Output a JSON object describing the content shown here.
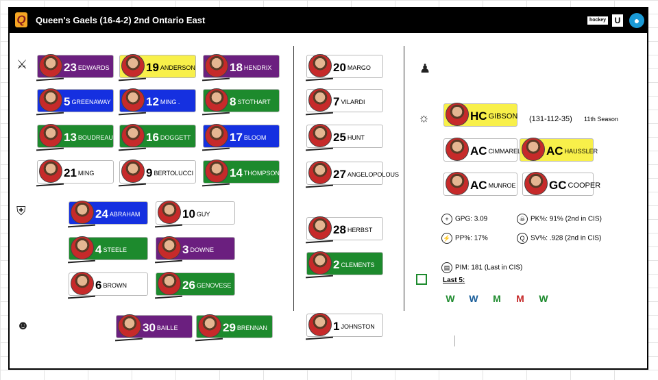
{
  "header": {
    "logo_letter": "Q",
    "title": "Queen's Gaels (16-4-2) 2nd Ontario East",
    "hockey_logo_text": "hockey",
    "u_logo_text": "U"
  },
  "icons": {
    "forwards": "sword-icon",
    "defence": "shield-icon",
    "goalies": "goalie-mask-icon",
    "management": "person-icon",
    "coaches": "whistle-icon"
  },
  "forwards": [
    {
      "number": "23",
      "name": "EDWARDS",
      "color": "purple"
    },
    {
      "number": "19",
      "name": "ANDERSON",
      "color": "yellow"
    },
    {
      "number": "18",
      "name": "HENDRIX",
      "color": "purple"
    },
    {
      "number": "5",
      "name": "GREENAWAY",
      "color": "blue"
    },
    {
      "number": "12",
      "name": "MING .",
      "color": "blue"
    },
    {
      "number": "8",
      "name": "STOTHART",
      "color": "green"
    },
    {
      "number": "13",
      "name": "BOUDREAU",
      "color": "green"
    },
    {
      "number": "16",
      "name": "DOGGETT",
      "color": "green"
    },
    {
      "number": "17",
      "name": "BLOOM",
      "color": "blue"
    },
    {
      "number": "21",
      "name": "MING",
      "color": "white"
    },
    {
      "number": "9",
      "name": "BERTOLUCCI",
      "color": "white"
    },
    {
      "number": "14",
      "name": "THOMPSON",
      "color": "green"
    }
  ],
  "defence": [
    {
      "number": "24",
      "name": "ABRAHAM",
      "color": "blue"
    },
    {
      "number": "10",
      "name": "GUY",
      "color": "white"
    },
    {
      "number": "4",
      "name": "STEELE",
      "color": "green"
    },
    {
      "number": "3",
      "name": "DOWNE",
      "color": "purple"
    },
    {
      "number": "6",
      "name": "BROWN",
      "color": "white"
    },
    {
      "number": "26",
      "name": "GENOVESE",
      "color": "green"
    }
  ],
  "goalies": [
    {
      "number": "30",
      "name": "BAILLE",
      "color": "purple"
    },
    {
      "number": "29",
      "name": "BRENNAN",
      "color": "green"
    }
  ],
  "extras": [
    {
      "number": "20",
      "name": "MARGO",
      "color": "white"
    },
    {
      "number": "7",
      "name": "VILARDI",
      "color": "white"
    },
    {
      "number": "25",
      "name": "HUNT",
      "color": "white"
    },
    {
      "number": "27",
      "name": "ANGELOPOLOUS",
      "color": "white"
    },
    {
      "number": "28",
      "name": "HERBST",
      "color": "white"
    },
    {
      "number": "2",
      "name": "CLEMENTS",
      "color": "green"
    },
    {
      "number": "1",
      "name": "JOHNSTON",
      "color": "white"
    }
  ],
  "coaches": {
    "hc": {
      "role": "HC",
      "name": "GIBSON",
      "color": "yellow",
      "record": "(131-112-35)",
      "season": "11th Season"
    },
    "ac1": {
      "role": "AC",
      "name": "CIMMARELLO",
      "color": "white"
    },
    "ac2": {
      "role": "AC",
      "name": "HAUSSLER",
      "color": "yellow"
    },
    "ac3": {
      "role": "AC",
      "name": "MUNROE",
      "color": "white"
    },
    "gc": {
      "role": "GC",
      "name": "COOPER",
      "color": "white"
    }
  },
  "stats": {
    "gpg": "GPG: 3.09",
    "pk": "PK%: 91% (2nd in CIS)",
    "pp": "PP%: 17%",
    "sv": "SV%: .928 (2nd in CIS)",
    "pim": "PIM: 181 (Last in CIS)",
    "last5_label": "Last 5:"
  },
  "last5": [
    {
      "letter": "W",
      "color": "#1d8a2d"
    },
    {
      "letter": "W",
      "color": "#1a5e9a"
    },
    {
      "letter": "M",
      "color": "#1d8a2d"
    },
    {
      "letter": "M",
      "color": "#c62a2a"
    },
    {
      "letter": "W",
      "color": "#1d8a2d"
    }
  ]
}
